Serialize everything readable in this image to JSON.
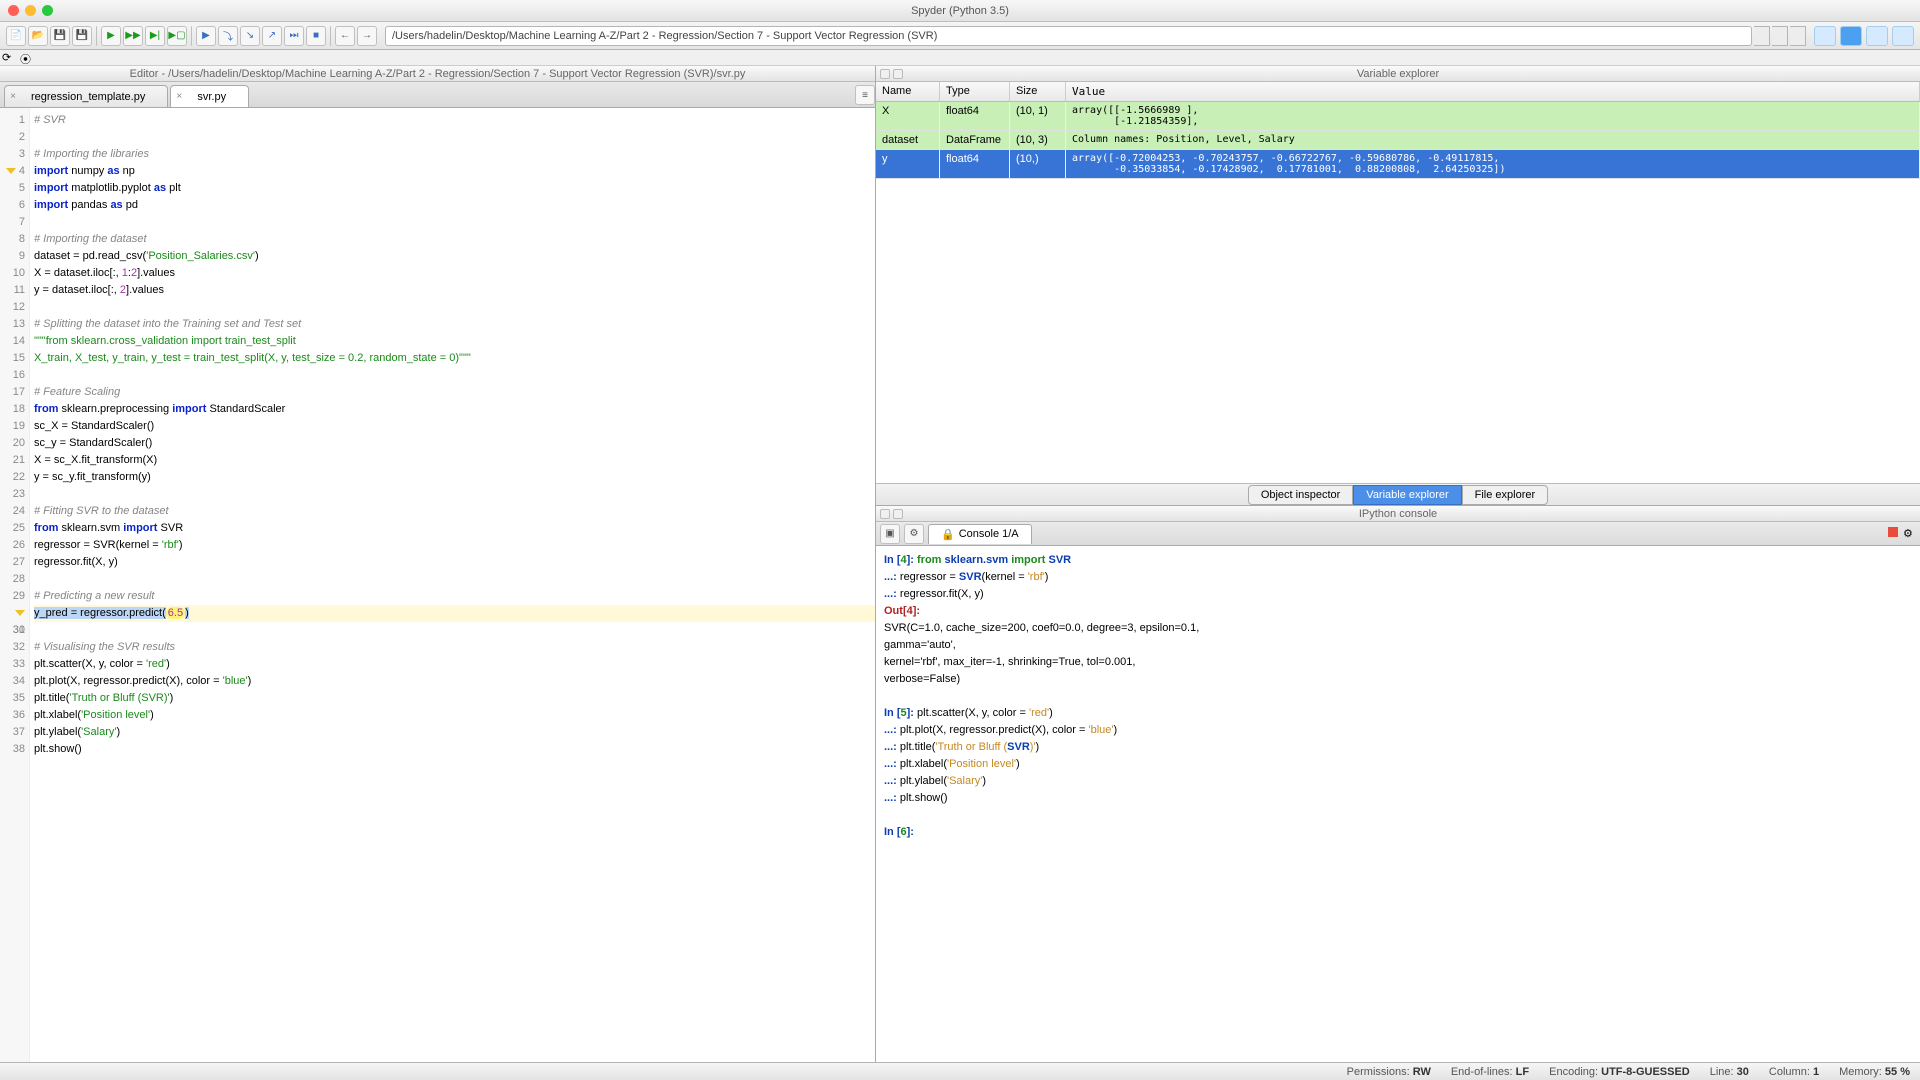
{
  "window": {
    "title": "Spyder (Python 3.5)"
  },
  "path": "/Users/hadelin/Desktop/Machine Learning A-Z/Part 2 - Regression/Section 7 - Support Vector Regression (SVR)",
  "editor": {
    "pane_title": "Editor - /Users/hadelin/Desktop/Machine Learning A-Z/Part 2 - Regression/Section 7 - Support Vector Regression (SVR)/svr.py",
    "tabs": [
      {
        "label": "regression_template.py",
        "active": false
      },
      {
        "label": "svr.py",
        "active": true
      }
    ],
    "highlight_line": 30,
    "lines": [
      "# SVR",
      "",
      "# Importing the libraries",
      "import numpy as np",
      "import matplotlib.pyplot as plt",
      "import pandas as pd",
      "",
      "# Importing the dataset",
      "dataset = pd.read_csv('Position_Salaries.csv')",
      "X = dataset.iloc[:, 1:2].values",
      "y = dataset.iloc[:, 2].values",
      "",
      "# Splitting the dataset into the Training set and Test set",
      "\"\"\"from sklearn.cross_validation import train_test_split",
      "X_train, X_test, y_train, y_test = train_test_split(X, y, test_size = 0.2, random_state = 0)\"\"\"",
      "",
      "# Feature Scaling",
      "from sklearn.preprocessing import StandardScaler",
      "sc_X = StandardScaler()",
      "sc_y = StandardScaler()",
      "X = sc_X.fit_transform(X)",
      "y = sc_y.fit_transform(y)",
      "",
      "# Fitting SVR to the dataset",
      "from sklearn.svm import SVR",
      "regressor = SVR(kernel = 'rbf')",
      "regressor.fit(X, y)",
      "",
      "# Predicting a new result",
      "y_pred = regressor.predict(6.5)",
      "",
      "# Visualising the SVR results",
      "plt.scatter(X, y, color = 'red')",
      "plt.plot(X, regressor.predict(X), color = 'blue')",
      "plt.title('Truth or Bluff (SVR)')",
      "plt.xlabel('Position level')",
      "plt.ylabel('Salary')",
      "plt.show()"
    ]
  },
  "varexplorer": {
    "pane_title": "Variable explorer",
    "headers": {
      "name": "Name",
      "type": "Type",
      "size": "Size",
      "value": "Value"
    },
    "rows": [
      {
        "name": "X",
        "type": "float64",
        "size": "(10, 1)",
        "value": "array([[-1.5666989 ],\n       [-1.21854359],",
        "class": "green"
      },
      {
        "name": "dataset",
        "type": "DataFrame",
        "size": "(10, 3)",
        "value": "Column names: Position, Level, Salary",
        "class": "green"
      },
      {
        "name": "y",
        "type": "float64",
        "size": "(10,)",
        "value": "array([-0.72004253, -0.70243757, -0.66722767, -0.59680786, -0.49117815,\n       -0.35033854, -0.17428902,  0.17781001,  0.88200808,  2.64250325])",
        "class": "blue"
      }
    ],
    "tabs": [
      {
        "label": "Object inspector",
        "active": false
      },
      {
        "label": "Variable explorer",
        "active": true
      },
      {
        "label": "File explorer",
        "active": false
      }
    ]
  },
  "ipython": {
    "pane_title": "IPython console",
    "tab": "Console 1/A",
    "lines": [
      {
        "t": "in",
        "n": 4,
        "code": "from sklearn.svm import SVR"
      },
      {
        "t": "cont",
        "code": "regressor = SVR(kernel = 'rbf')"
      },
      {
        "t": "cont",
        "code": "regressor.fit(X, y)"
      },
      {
        "t": "out",
        "n": 4,
        "text": ""
      },
      {
        "t": "plain",
        "text": "SVR(C=1.0, cache_size=200, coef0=0.0, degree=3, epsilon=0.1,"
      },
      {
        "t": "plain",
        "text": "  gamma='auto',"
      },
      {
        "t": "plain",
        "text": "  kernel='rbf', max_iter=-1, shrinking=True, tol=0.001,"
      },
      {
        "t": "plain",
        "text": "  verbose=False)"
      },
      {
        "t": "blank"
      },
      {
        "t": "in",
        "n": 5,
        "code": "plt.scatter(X, y, color = 'red')"
      },
      {
        "t": "cont",
        "code": "plt.plot(X, regressor.predict(X), color = 'blue')"
      },
      {
        "t": "cont",
        "code": "plt.title('Truth or Bluff (SVR)')"
      },
      {
        "t": "cont",
        "code": "plt.xlabel('Position level')"
      },
      {
        "t": "cont",
        "code": "plt.ylabel('Salary')"
      },
      {
        "t": "cont",
        "code": "plt.show()"
      },
      {
        "t": "blank"
      },
      {
        "t": "in",
        "n": 6,
        "code": ""
      }
    ]
  },
  "status": {
    "permissions_label": "Permissions:",
    "permissions": "RW",
    "eol_label": "End-of-lines:",
    "eol": "LF",
    "encoding_label": "Encoding:",
    "encoding": "UTF-8-GUESSED",
    "line_label": "Line:",
    "line": "30",
    "column_label": "Column:",
    "column": "1",
    "memory_label": "Memory:",
    "memory": "55 %"
  }
}
